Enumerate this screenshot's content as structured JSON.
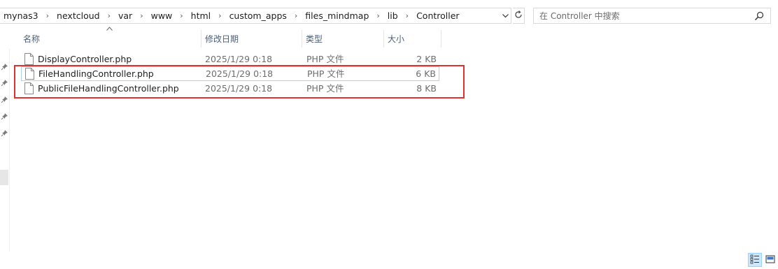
{
  "address_bar": {
    "crumbs": [
      "mynas3",
      "nextcloud",
      "var",
      "www",
      "html",
      "custom_apps",
      "files_mindmap",
      "lib",
      "Controller"
    ],
    "separator": "›",
    "dropdown_icon": "chevron-down-icon",
    "refresh_icon": "refresh-icon"
  },
  "search": {
    "placeholder": "在 Controller 中搜索",
    "icon": "search-icon"
  },
  "columns": {
    "name": "名称",
    "modified": "修改日期",
    "type": "类型",
    "size": "大小"
  },
  "files": [
    {
      "name": "DisplayController.php",
      "modified": "2025/1/29 0:18",
      "type": "PHP 文件",
      "size": "2 KB",
      "selected": false
    },
    {
      "name": "FileHandlingController.php",
      "modified": "2025/1/29 0:18",
      "type": "PHP 文件",
      "size": "6 KB",
      "selected": true
    },
    {
      "name": "PublicFileHandlingController.php",
      "modified": "2025/1/29 0:18",
      "type": "PHP 文件",
      "size": "8 KB",
      "selected": false
    }
  ],
  "highlight_color": "#e0312f",
  "selection_color": "#a5d7ef",
  "header_text_color": "#4c607a",
  "view_buttons": [
    "details-view-icon",
    "large-icons-view-icon"
  ]
}
